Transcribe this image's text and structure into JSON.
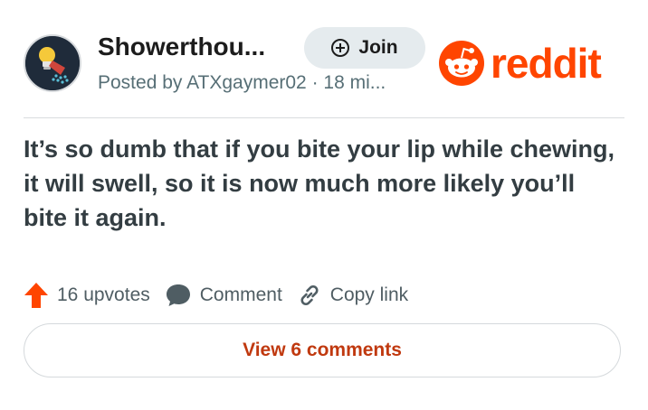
{
  "post": {
    "subreddit": "Showerthou...",
    "meta": "Posted by ATXgaymer02 · 18 mi...",
    "join_label": "Join",
    "text": "It’s so dumb that if you bite your lip while chewing, it will swell, so it is now much more likely you’ll bite it again."
  },
  "brand": {
    "wordmark": "reddit",
    "color": "#ff4500"
  },
  "actions": {
    "upvotes": "16 upvotes",
    "comment": "Comment",
    "copy_link": "Copy link"
  },
  "view_comments": "View 6 comments",
  "colors": {
    "upvote": "#ff4500",
    "link_button_text": "#c0390f",
    "join_bg": "#e5ebee"
  },
  "icons": [
    "showerhead-lightbulb-avatar-icon",
    "plus-circle-icon",
    "reddit-snoo-icon",
    "upvote-arrow-icon",
    "comment-bubble-icon",
    "link-icon"
  ]
}
